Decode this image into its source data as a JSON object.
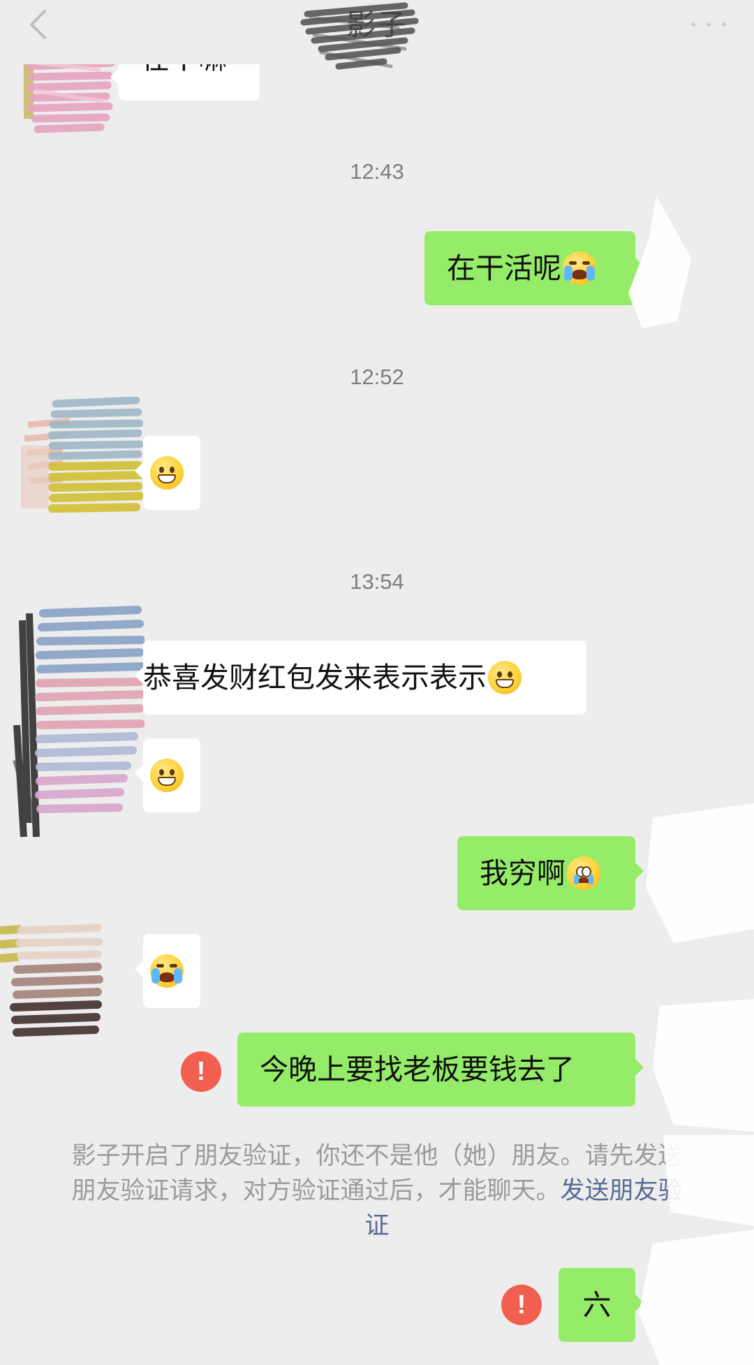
{
  "header": {
    "title": "影子",
    "back_icon": "chevron-left-icon",
    "more_icon": "more-dots-icon"
  },
  "messages": [
    {
      "from": "other",
      "text": "在干嘛"
    },
    {
      "time": "12:43"
    },
    {
      "from": "me",
      "text": "在干活呢",
      "emoji": "crying-laughing-emoji"
    },
    {
      "time": "12:52"
    },
    {
      "from": "other",
      "text": "",
      "emoji": "grinning-emoji"
    },
    {
      "time": "13:54"
    },
    {
      "from": "other",
      "text": "恭喜发财红包发来表示表示",
      "emoji": "grinning-emoji"
    },
    {
      "from": "other",
      "text": "",
      "emoji": "grinning-emoji"
    },
    {
      "from": "me",
      "text": "我穷啊",
      "emoji": "pleading-crying-emoji"
    },
    {
      "from": "other",
      "text": "",
      "emoji": "crying-laughing-emoji"
    },
    {
      "from": "me",
      "text": "今晚上要找老板要钱去了",
      "status": "failed"
    },
    {
      "from": "me",
      "text": "六",
      "status": "failed"
    }
  ],
  "system_notice": {
    "text": "影子开启了朋友验证，你还不是他（她）朋友。请先发送朋友验证请求，对方验证通过后，才能聊天。",
    "link": "发送朋友验证"
  },
  "colors": {
    "background": "#ededed",
    "incoming_bubble": "#ffffff",
    "outgoing_bubble": "#95ec69",
    "error": "#f25e4f",
    "link": "#576b95"
  }
}
